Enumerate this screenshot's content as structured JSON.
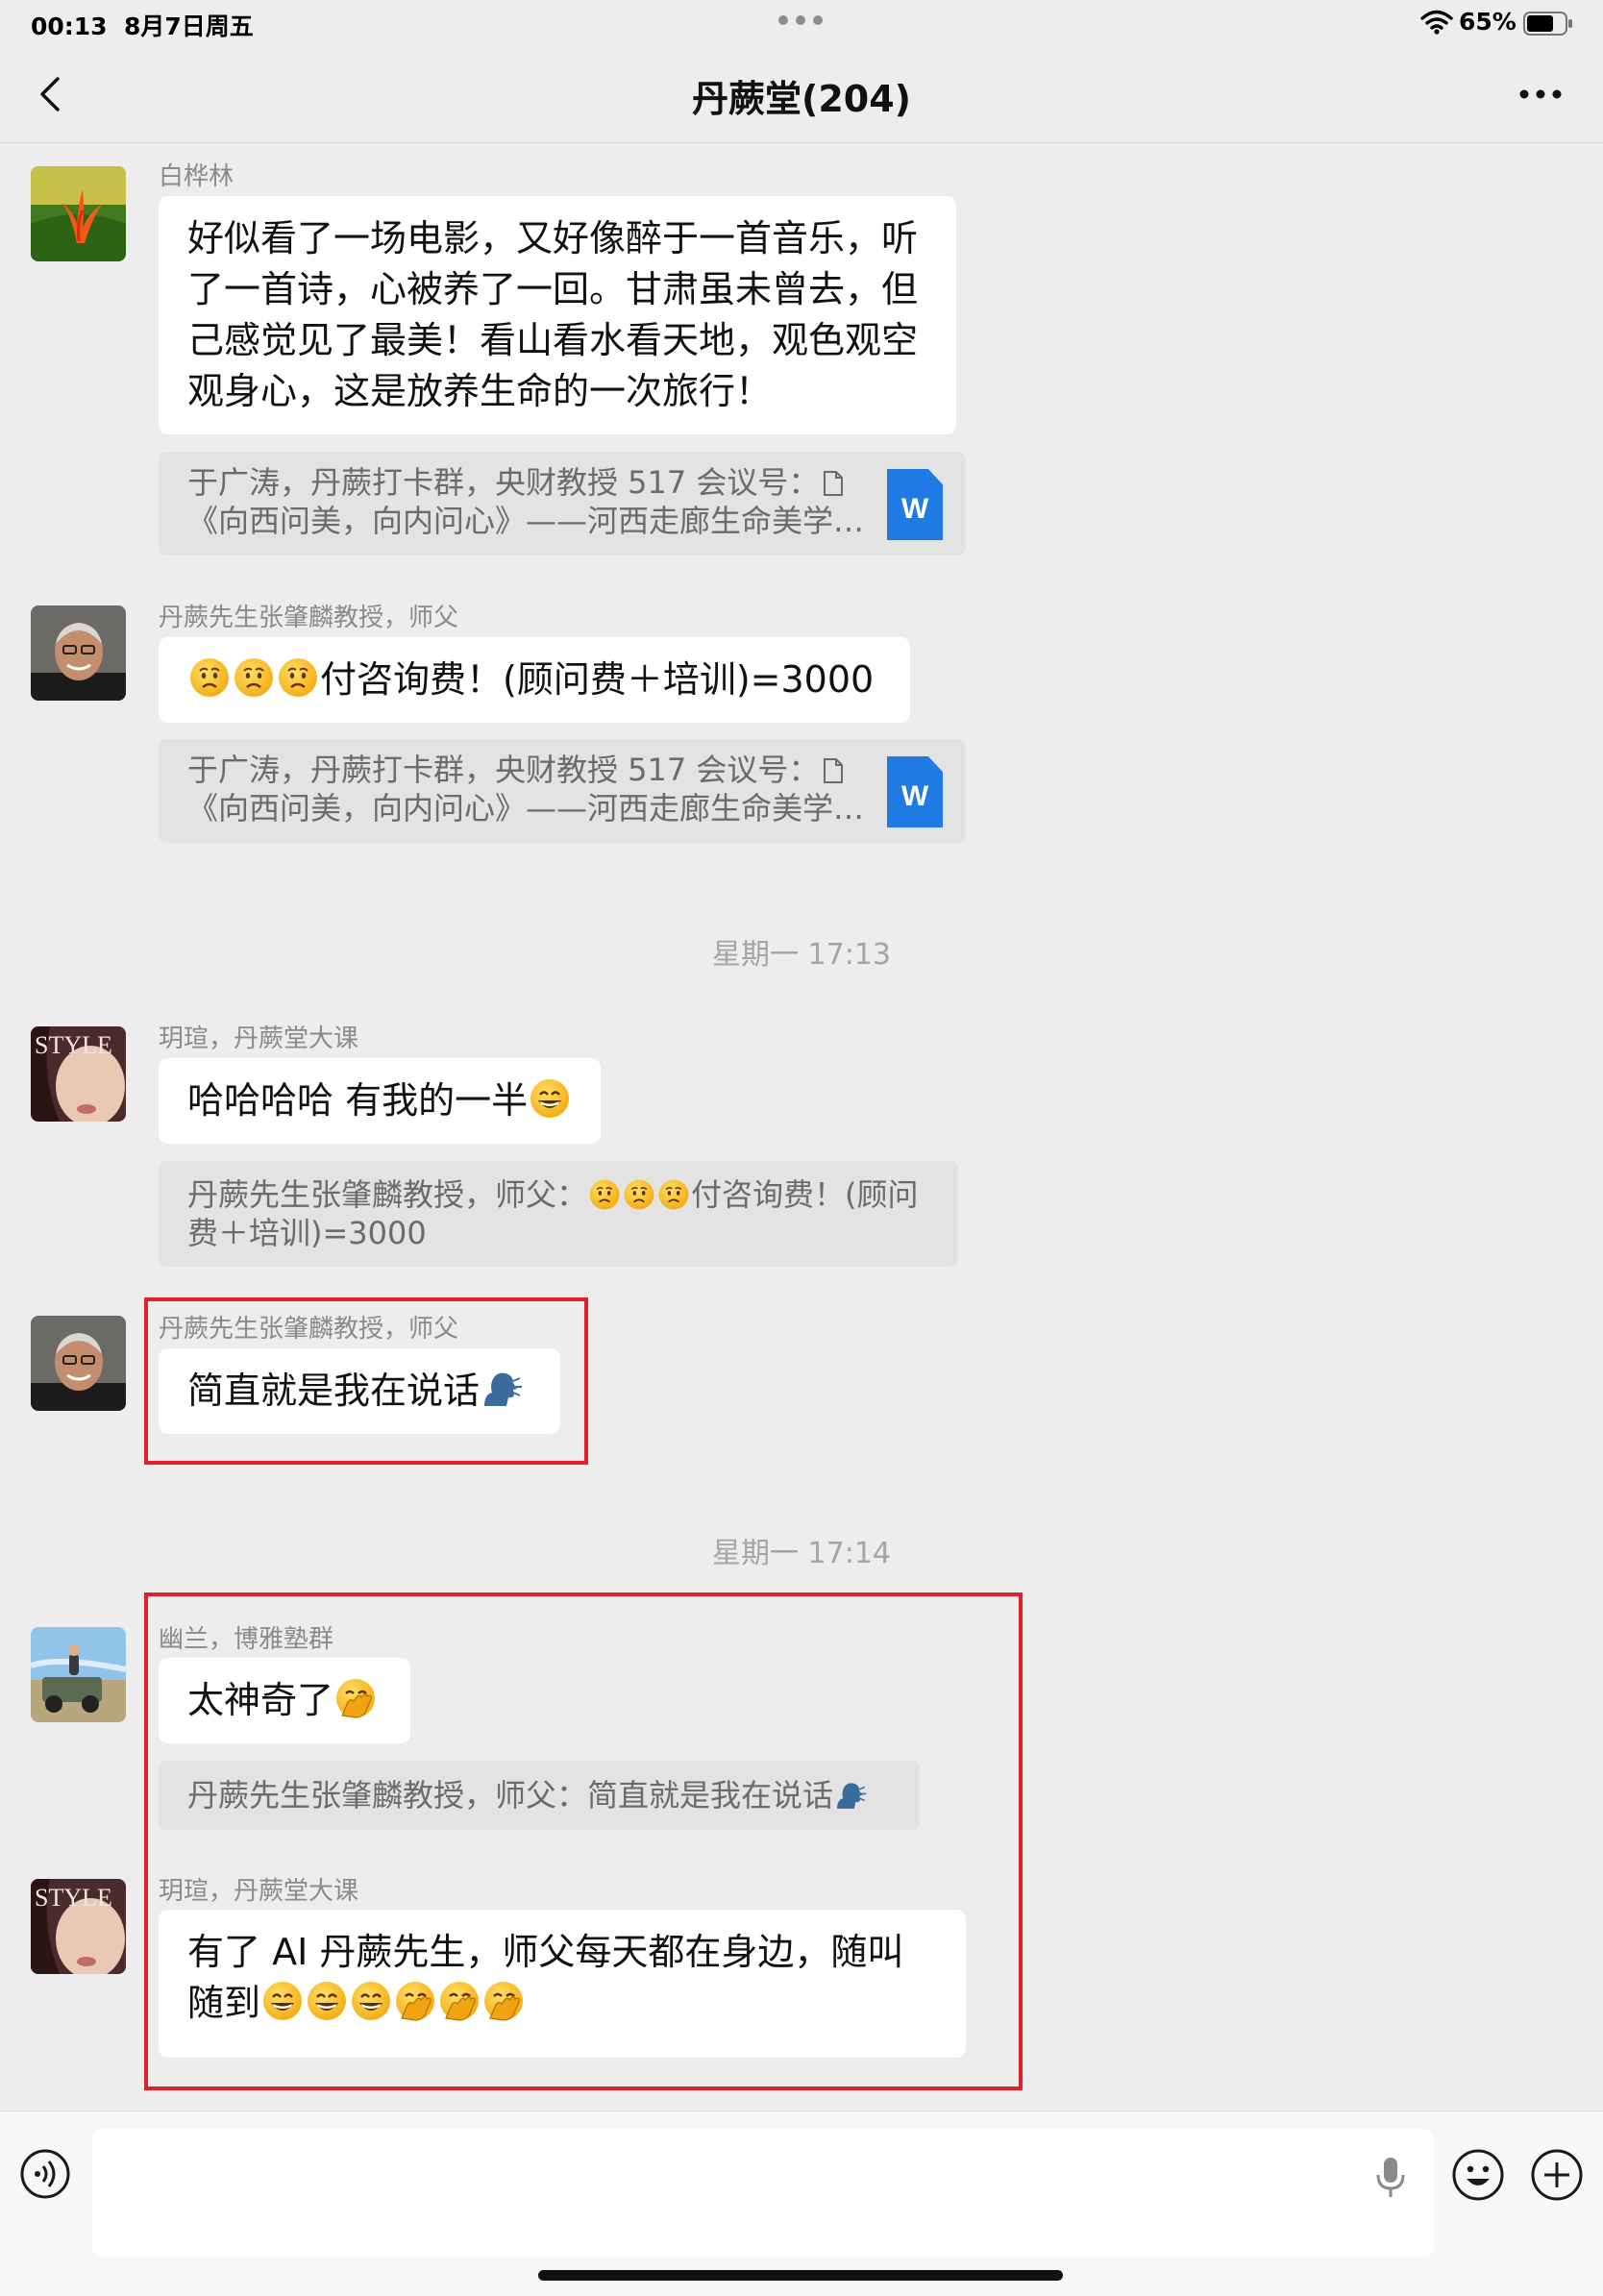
{
  "status_bar": {
    "time": "00:13",
    "date": "8月7日周五",
    "battery": "65%"
  },
  "nav": {
    "title": "丹蕨堂(204)"
  },
  "messages": [
    {
      "sender": "白桦林",
      "text": "好似看了一场电影，又好像醉于一首音乐，听了一首诗，心被养了一回。甘肃虽未曾去，但己感觉见了最美！看山看水看天地，观色观空观身心，这是放养生命的一次旅行！",
      "quote_line1": "于广涛，丹蕨打卡群，央财教授 517 会议号：",
      "quote_line2": "《向西问美，向内问心》——河西走廊生命美学修..."
    },
    {
      "sender": "丹蕨先生张肇麟教授，师父",
      "text": "付咨询费！(顾问费＋培训)=3000",
      "quote_line1": "于广涛，丹蕨打卡群，央财教授 517 会议号：",
      "quote_line2": "《向西问美，向内问心》——河西走廊生命美学修..."
    },
    {
      "sender": "玥瑄，丹蕨堂大课",
      "text": "哈哈哈哈 有我的一半",
      "quote_prefix": "丹蕨先生张肇麟教授，师父：",
      "quote_text": "付咨询费！(顾问费＋培训)=3000"
    },
    {
      "sender": "丹蕨先生张肇麟教授，师父",
      "text": "简直就是我在说话"
    },
    {
      "sender": "幽兰，博雅塾群",
      "text": "太神奇了",
      "quote_text": "丹蕨先生张肇麟教授，师父：简直就是我在说话"
    },
    {
      "sender": "玥瑄，丹蕨堂大课",
      "text": "有了 AI 丹蕨先生，师父每天都在身边，随叫随到"
    }
  ],
  "timestamps": [
    "星期一 17:13",
    "星期一 17:14"
  ],
  "word_badge": "W",
  "icons": {
    "emoji_confused": "confused-face",
    "emoji_grin": "grinning-face",
    "emoji_hand_over_mouth": "face-with-hand-over-mouth",
    "emoji_speaking": "speaking-head"
  },
  "colors": {
    "highlight": "#e0202a",
    "word": "#1f7ae3",
    "background": "#ededed"
  }
}
